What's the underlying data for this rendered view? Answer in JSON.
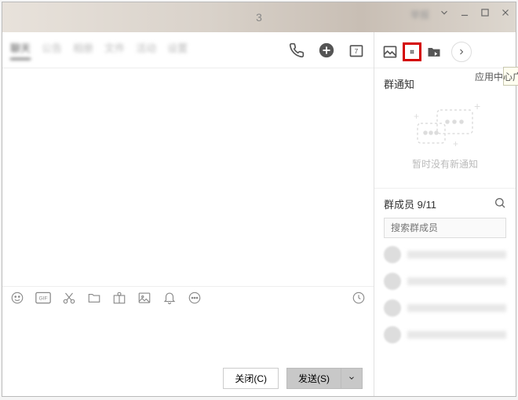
{
  "titlebar": {
    "title": "3",
    "label_blur": "举报"
  },
  "tabs": [
    "聊天",
    "公告",
    "相册",
    "文件",
    "活动",
    "设置"
  ],
  "tooltip": "应用中心广场页面",
  "buttons": {
    "close": "关闭(C)",
    "send": "发送(S)"
  },
  "notice": {
    "title": "群通知",
    "empty": "暂时没有新通知"
  },
  "members": {
    "title": "群成员 9/11",
    "search_placeholder": "搜索群成员"
  }
}
